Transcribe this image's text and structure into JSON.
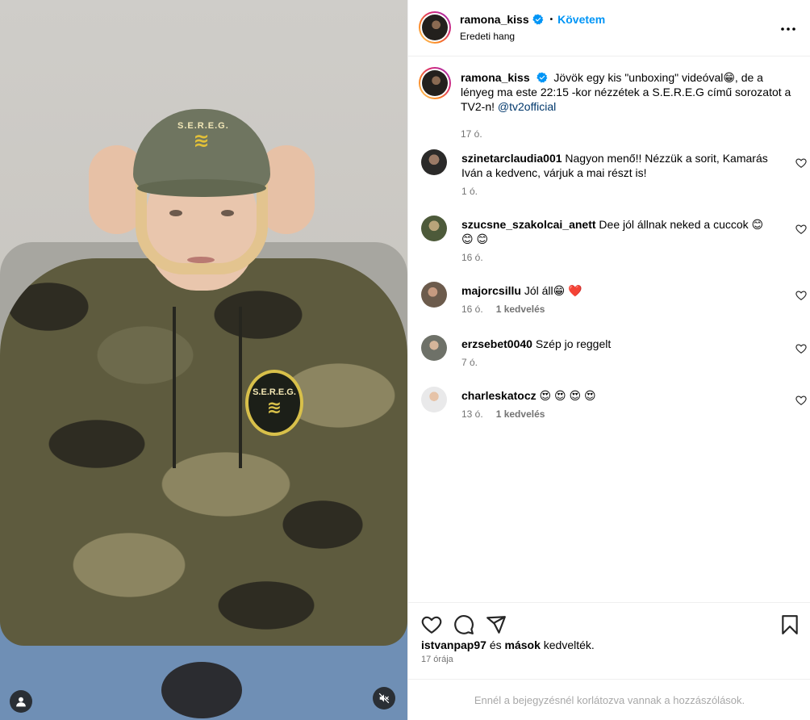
{
  "post": {
    "username": "ramona_kiss",
    "follow_label": "Követem",
    "subtitle": "Eredeti hang",
    "caption": {
      "username": "ramona_kiss",
      "text": "Jövök egy kis \"unboxing\" videóval😁, de a lényeg ma este 22:15 -kor nézzétek a S.E.R.E.G című sorozatot a TV2-n!",
      "mention": "@tv2official",
      "time": "17 ó."
    }
  },
  "media": {
    "cap_text": "S.E.R.E.G.",
    "patch_text": "S.E.R.E.G."
  },
  "comments": [
    {
      "username": "szinetarclaudia001",
      "text": "Nagyon menő!! Nézzük a sorit, Kamarás Iván a kedvenc, várjuk a mai részt is!",
      "time": "1 ó.",
      "likes": ""
    },
    {
      "username": "szucsne_szakolcai_anett",
      "text": "Dee jól állnak neked a cuccok 😊 😊 😊",
      "time": "16 ó.",
      "likes": ""
    },
    {
      "username": "majorcsillu",
      "text": "Jól áll😁 ❤️",
      "time": "16 ó.",
      "likes": "1 kedvelés"
    },
    {
      "username": "erzsebet0040",
      "text": "Szép jo reggelt",
      "time": "7 ó.",
      "likes": ""
    },
    {
      "username": "charleskatocz",
      "text": "😍 😍 😍 😍",
      "time": "13 ó.",
      "likes": "1 kedvelés"
    }
  ],
  "footer": {
    "liked_by_user": "istvanpap97",
    "liked_by_and": "és",
    "liked_by_others": "mások",
    "liked_suffix": "kedvelték.",
    "posted": "17 órája",
    "restricted": "Ennél a bejegyzésnél korlátozva vannak a hozzászólások."
  },
  "colors": {
    "accent": "#0095f6",
    "verified": "#0095f6",
    "secondary_text": "#737373",
    "mention": "#00376b"
  },
  "icons": [
    "verified-icon",
    "more-icon",
    "heart-icon",
    "comment-icon",
    "share-icon",
    "bookmark-icon",
    "user-icon",
    "mute-icon"
  ]
}
